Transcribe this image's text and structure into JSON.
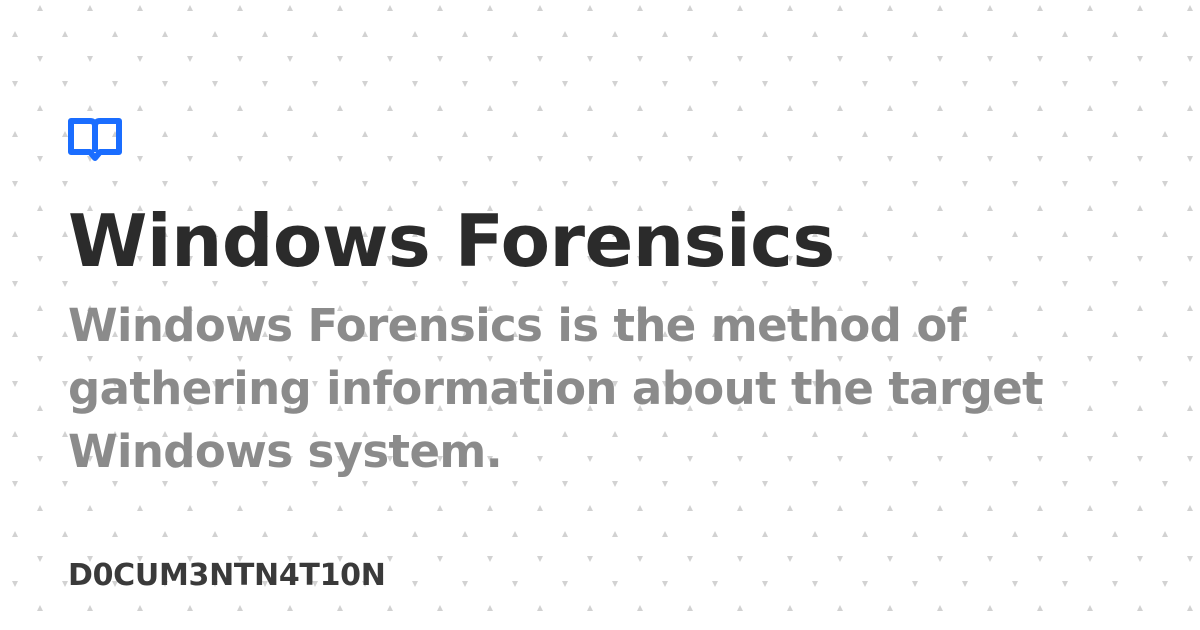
{
  "logo": {
    "icon": "book-icon",
    "color": "#1a6dff"
  },
  "title": "Windows Forensics",
  "description": "Windows Forensics is the method of gathering information about the target Windows system.",
  "footer": {
    "site_name": "D0CUM3NTN4T10N"
  },
  "colors": {
    "background": "#ffffff",
    "title": "#2b2b2b",
    "description": "#8b8b8b",
    "footer": "#3a3a3a",
    "pattern": "#d2d2d2"
  }
}
